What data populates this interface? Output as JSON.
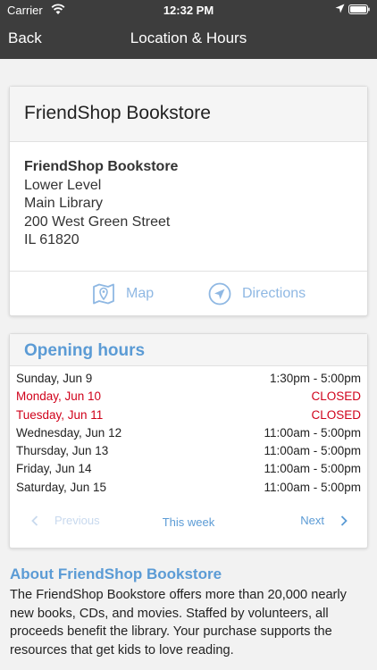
{
  "status_bar": {
    "carrier": "Carrier",
    "time": "12:32 PM",
    "icons": [
      "wifi-icon",
      "location-arrow-icon",
      "battery-icon"
    ]
  },
  "nav": {
    "back_label": "Back",
    "title": "Location & Hours"
  },
  "store": {
    "header": "FriendShop Bookstore",
    "address": {
      "name": "FriendShop Bookstore",
      "line1": "Lower Level",
      "line2": "Main Library",
      "line3": "200 West Green Street",
      "line4": "IL 61820"
    },
    "actions": {
      "map_label": "Map",
      "map_icon": "map-pin-icon",
      "directions_label": "Directions",
      "directions_icon": "navigation-arrow-icon"
    }
  },
  "hours": {
    "title": "Opening hours",
    "rows": [
      {
        "day": "Sunday, Jun 9",
        "time": "1:30pm - 5:00pm",
        "closed": false
      },
      {
        "day": "Monday, Jun 10",
        "time": "CLOSED",
        "closed": true
      },
      {
        "day": "Tuesday, Jun 11",
        "time": "CLOSED",
        "closed": true
      },
      {
        "day": "Wednesday, Jun 12",
        "time": "11:00am - 5:00pm",
        "closed": false
      },
      {
        "day": "Thursday, Jun 13",
        "time": "11:00am - 5:00pm",
        "closed": false
      },
      {
        "day": "Friday, Jun 14",
        "time": "11:00am - 5:00pm",
        "closed": false
      },
      {
        "day": "Saturday, Jun 15",
        "time": "11:00am - 5:00pm",
        "closed": false
      }
    ],
    "pager": {
      "previous_label": "Previous",
      "this_week_label": "This week",
      "next_label": "Next"
    }
  },
  "about": {
    "title": "About FriendShop Bookstore",
    "text": "The FriendShop Bookstore offers more than 20,000 nearly new books, CDs, and movies. Staffed by volunteers, all proceeds benefit the library. Your purchase supports the resources that get kids to love reading."
  },
  "colors": {
    "navbar": "#3d3d3d",
    "accent": "#5b9bd5",
    "action_light": "#8fb8e3",
    "closed": "#d0021b",
    "background": "#f2f2f2"
  }
}
